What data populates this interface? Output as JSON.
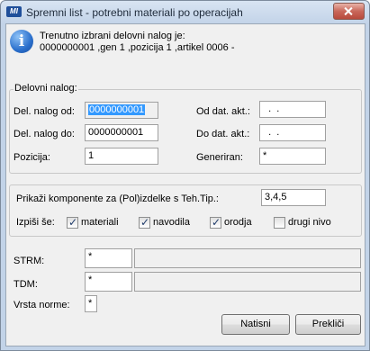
{
  "window": {
    "title": "Spremni list - potrebni materiali po operacijah",
    "app_icon": "MI"
  },
  "message": {
    "line1": "Trenutno izbrani delovni nalog je:",
    "line2": "0000000001 ,gen 1 ,pozicija 1 ,artikel 0006 -"
  },
  "delovni_nalog": {
    "legend": "Delovni nalog:",
    "od_label": "Del. nalog od:",
    "od_value": "0000000001",
    "do_label": "Del. nalog do:",
    "do_value": "0000000001",
    "pozicija_label": "Pozicija:",
    "pozicija_value": "1",
    "od_dat_label": "Od dat. akt.:",
    "od_dat_value": "  .  .",
    "do_dat_label": "Do dat. akt.:",
    "do_dat_value": "  .  .",
    "generiran_label": "Generiran:",
    "generiran_value": "*"
  },
  "komponente": {
    "label": "Prikaži komponente za (Pol)izdelke s Teh.Tip.:",
    "value": "3,4,5",
    "izpisi_label": "Izpiši še:",
    "materiali": {
      "label": "materiali",
      "checked": true
    },
    "navodila": {
      "label": "navodila",
      "checked": true
    },
    "orodja": {
      "label": "orodja",
      "checked": true
    },
    "drugi_nivo": {
      "label": "drugi nivo",
      "checked": false
    }
  },
  "strm": {
    "label": "STRM:",
    "value": "*"
  },
  "tdm": {
    "label": "TDM:",
    "value": "*"
  },
  "vrsta_norme": {
    "label": "Vrsta norme:",
    "value": "*"
  },
  "buttons": {
    "natisni": "Natisni",
    "preklici": "Prekliči"
  },
  "icons": {
    "info": "info-icon",
    "close": "close-icon",
    "check": "check-icon"
  }
}
